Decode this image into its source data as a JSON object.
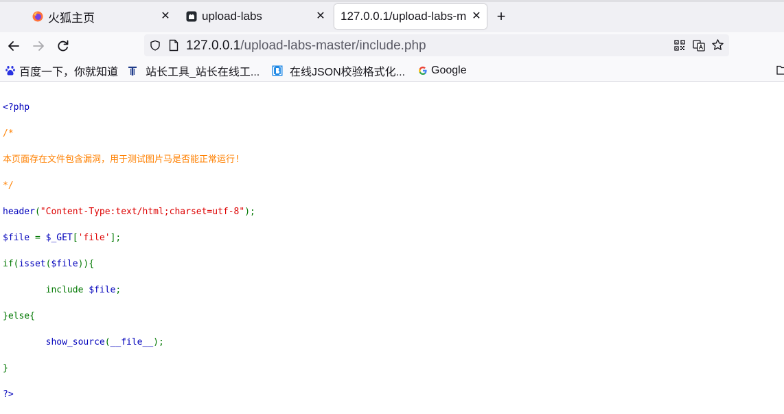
{
  "tabs": [
    {
      "title": "火狐主页",
      "icon": "firefox-icon",
      "active": false
    },
    {
      "title": "upload-labs",
      "icon": "github-icon",
      "active": false
    },
    {
      "title": "127.0.0.1/upload-labs-m",
      "icon": "none",
      "active": true
    }
  ],
  "toolbar": {
    "new_tab": "+"
  },
  "address": {
    "host": "127.0.0.1",
    "path": "/upload-labs-master/include.php"
  },
  "bookmarks": [
    {
      "label": "百度一下，你就知道",
      "icon": "baidu-icon"
    },
    {
      "label": "站长工具_站长在线工...",
      "icon": "chinaz-icon"
    },
    {
      "label": "在线JSON校验格式化...",
      "icon": "bejson-icon"
    },
    {
      "label": "Google",
      "icon": "google-icon"
    }
  ],
  "colors": {
    "php_default": "#0000BB",
    "php_comment": "#FF8000",
    "php_keyword": "#007700",
    "php_string": "#DD0000"
  },
  "source": {
    "l1": "<?php",
    "l2": "/*",
    "l3": "本页面存在文件包含漏洞，用于测试图片马是否能正常运行!",
    "l4": "*/",
    "l5a": "header",
    "l5b": "(",
    "l5c": "\"Content-Type:text/html;charset=utf-8\"",
    "l5d": ");",
    "l6a": "$file ",
    "l6b": "= ",
    "l6c": "$_GET",
    "l6d": "[",
    "l6e": "'file'",
    "l6f": "];",
    "l7a": "if(",
    "l7b": "isset",
    "l7c": "(",
    "l7d": "$file",
    "l7e": ")){",
    "l8a": "        include ",
    "l8b": "$file",
    "l8c": ";",
    "l9": "}else{",
    "l10a": "        ",
    "l10b": "show_source",
    "l10c": "(",
    "l10d": "__file__",
    "l10e": ");",
    "l11": "}",
    "l12": "?>"
  }
}
